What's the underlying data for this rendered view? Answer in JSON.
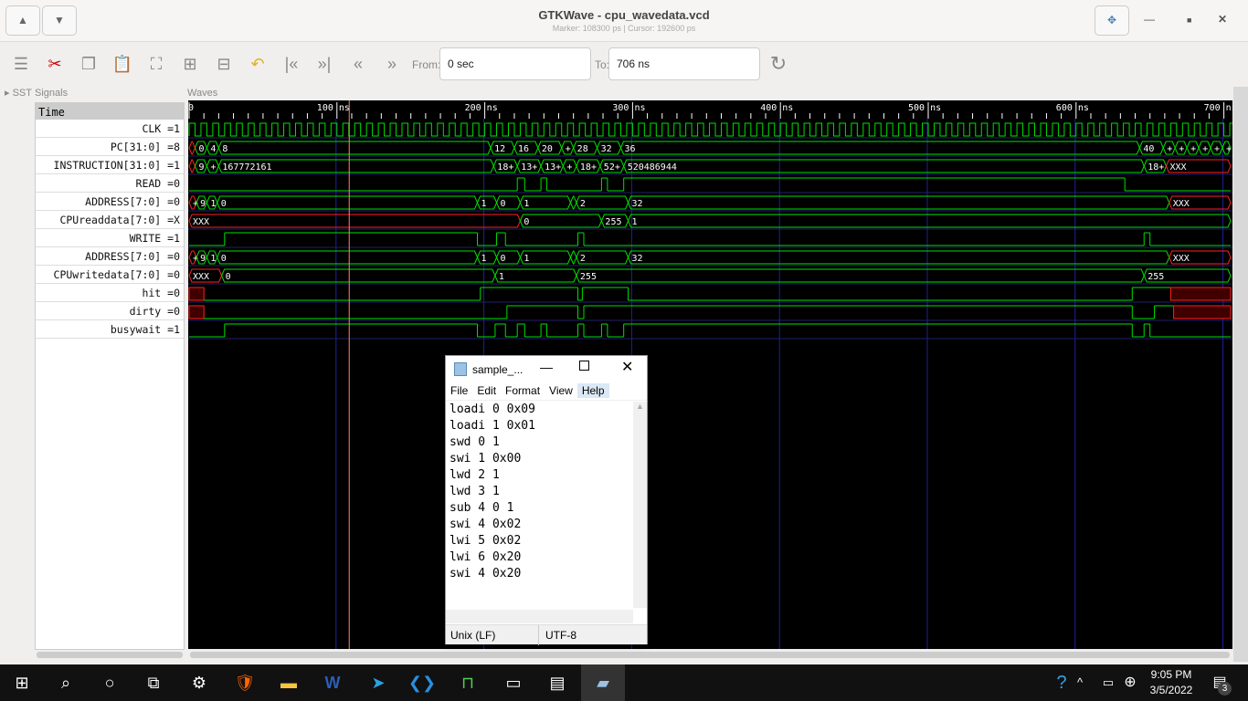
{
  "window": {
    "title": "GTKWave - cpu_wavedata.vcd",
    "subtitle": "Marker: 108300 ps  |  Cursor: 192600 ps"
  },
  "toolbar": {
    "from_label": "From:",
    "from_value": "0 sec",
    "to_label": "To:",
    "to_value": "706 ns"
  },
  "panels": {
    "sst": "SST",
    "signals": "Signals",
    "waves": "Waves",
    "time": "Time"
  },
  "ruler": [
    "0",
    "100 ns",
    "200 ns",
    "300 ns",
    "400 ns",
    "500 ns",
    "600 ns",
    "700 ns"
  ],
  "marker_ns": 108.3,
  "signals": [
    {
      "name": "CLK =1",
      "type": "clock",
      "period": 8
    },
    {
      "name": "PC[31:0] =8",
      "type": "bus",
      "segs": [
        [
          0,
          "X"
        ],
        [
          4,
          "0"
        ],
        [
          12,
          "4"
        ],
        [
          20,
          "8"
        ],
        [
          204,
          "12"
        ],
        [
          220,
          "16"
        ],
        [
          236,
          "20"
        ],
        [
          252,
          "+"
        ],
        [
          260,
          "28"
        ],
        [
          276,
          "32"
        ],
        [
          292,
          "36"
        ],
        [
          643,
          "40"
        ],
        [
          659,
          "+"
        ],
        [
          667,
          "+"
        ],
        [
          675,
          "+"
        ],
        [
          683,
          "+"
        ],
        [
          691,
          "+"
        ],
        [
          699,
          "+"
        ]
      ]
    },
    {
      "name": "INSTRUCTION[31:0] =1",
      "type": "bus",
      "segs": [
        [
          0,
          "X+"
        ],
        [
          4,
          "9"
        ],
        [
          12,
          "+"
        ],
        [
          20,
          "167772161"
        ],
        [
          206,
          "18+"
        ],
        [
          222,
          "13+"
        ],
        [
          238,
          "13+"
        ],
        [
          253,
          "+"
        ],
        [
          262,
          "18+"
        ],
        [
          278,
          "52+"
        ],
        [
          294,
          "520486944"
        ],
        [
          646,
          "18+"
        ],
        [
          661,
          "XXX"
        ]
      ]
    },
    {
      "name": "READ =0",
      "type": "bit",
      "edges": [
        [
          0,
          0
        ],
        [
          222,
          1
        ],
        [
          227,
          0
        ],
        [
          238,
          1
        ],
        [
          242,
          0
        ],
        [
          279,
          1
        ],
        [
          283,
          0
        ],
        [
          294,
          1
        ],
        [
          633,
          0
        ]
      ]
    },
    {
      "name": "ADDRESS[7:0] =0",
      "type": "bus",
      "segs": [
        [
          0,
          "X+"
        ],
        [
          5,
          "9"
        ],
        [
          12,
          "1"
        ],
        [
          19,
          "0"
        ],
        [
          195,
          "1"
        ],
        [
          208,
          "0"
        ],
        [
          224,
          "1"
        ],
        [
          258,
          ""
        ],
        [
          262,
          "2"
        ],
        [
          297,
          "32"
        ],
        [
          663,
          "XXX"
        ]
      ]
    },
    {
      "name": "CPUreaddata[7:0] =X",
      "type": "bus",
      "segs": [
        [
          0,
          "XXX"
        ],
        [
          224,
          "0"
        ],
        [
          279,
          "255"
        ],
        [
          297,
          "1"
        ]
      ]
    },
    {
      "name": "WRITE =1",
      "type": "bit",
      "edges": [
        [
          0,
          0
        ],
        [
          24,
          1
        ],
        [
          195,
          0
        ],
        [
          208,
          1
        ],
        [
          214,
          0
        ],
        [
          263,
          1
        ],
        [
          267,
          0
        ],
        [
          646,
          1
        ],
        [
          650,
          0
        ]
      ]
    },
    {
      "name": "ADDRESS[7:0] =0",
      "type": "bus",
      "segs": [
        [
          0,
          "X+"
        ],
        [
          5,
          "9"
        ],
        [
          12,
          "1"
        ],
        [
          19,
          "0"
        ],
        [
          195,
          "1"
        ],
        [
          208,
          "0"
        ],
        [
          224,
          "1"
        ],
        [
          258,
          ""
        ],
        [
          262,
          "2"
        ],
        [
          297,
          "32"
        ],
        [
          663,
          "XXX"
        ]
      ]
    },
    {
      "name": "CPUwritedata[7:0] =0",
      "type": "bus",
      "segs": [
        [
          0,
          "XXX"
        ],
        [
          22,
          "0"
        ],
        [
          207,
          "1"
        ],
        [
          262,
          "255"
        ],
        [
          646,
          "255"
        ]
      ]
    },
    {
      "name": "hit =0",
      "type": "bit",
      "edges": [
        [
          0,
          "x"
        ],
        [
          10,
          0
        ],
        [
          197,
          1
        ],
        [
          263,
          0
        ],
        [
          266,
          1
        ],
        [
          297,
          0
        ],
        [
          638,
          1
        ],
        [
          664,
          "x"
        ]
      ]
    },
    {
      "name": "dirty =0",
      "type": "bit",
      "edges": [
        [
          0,
          "x"
        ],
        [
          10,
          0
        ],
        [
          215,
          1
        ],
        [
          263,
          0
        ],
        [
          267,
          1
        ],
        [
          638,
          0
        ],
        [
          653,
          1
        ],
        [
          666,
          "x"
        ]
      ]
    },
    {
      "name": "busywait =1",
      "type": "bit",
      "edges": [
        [
          0,
          0
        ],
        [
          24,
          1
        ],
        [
          195,
          0
        ],
        [
          207,
          1
        ],
        [
          214,
          0
        ],
        [
          222,
          1
        ],
        [
          227,
          0
        ],
        [
          238,
          1
        ],
        [
          242,
          0
        ],
        [
          263,
          1
        ],
        [
          267,
          0
        ],
        [
          279,
          1
        ],
        [
          283,
          0
        ],
        [
          294,
          1
        ],
        [
          638,
          0
        ],
        [
          646,
          1
        ],
        [
          650,
          0
        ]
      ]
    }
  ],
  "notepad": {
    "title": "sample_...",
    "menu": [
      "File",
      "Edit",
      "Format",
      "View",
      "Help"
    ],
    "lines": [
      "loadi 0 0x09",
      "loadi 1 0x01",
      "swd 0 1",
      "swi 1 0x00",
      "lwd 2 1",
      "lwd 3 1",
      "sub 4 0 1",
      "swi 4 0x02",
      "lwi 5 0x02",
      "lwi 6 0x20",
      "swi 4 0x20"
    ],
    "status_eol": "Unix (LF)",
    "status_enc": "UTF-8"
  },
  "taskbar": {
    "time": "9:05 PM",
    "date": "3/5/2022",
    "notifications": "3"
  }
}
